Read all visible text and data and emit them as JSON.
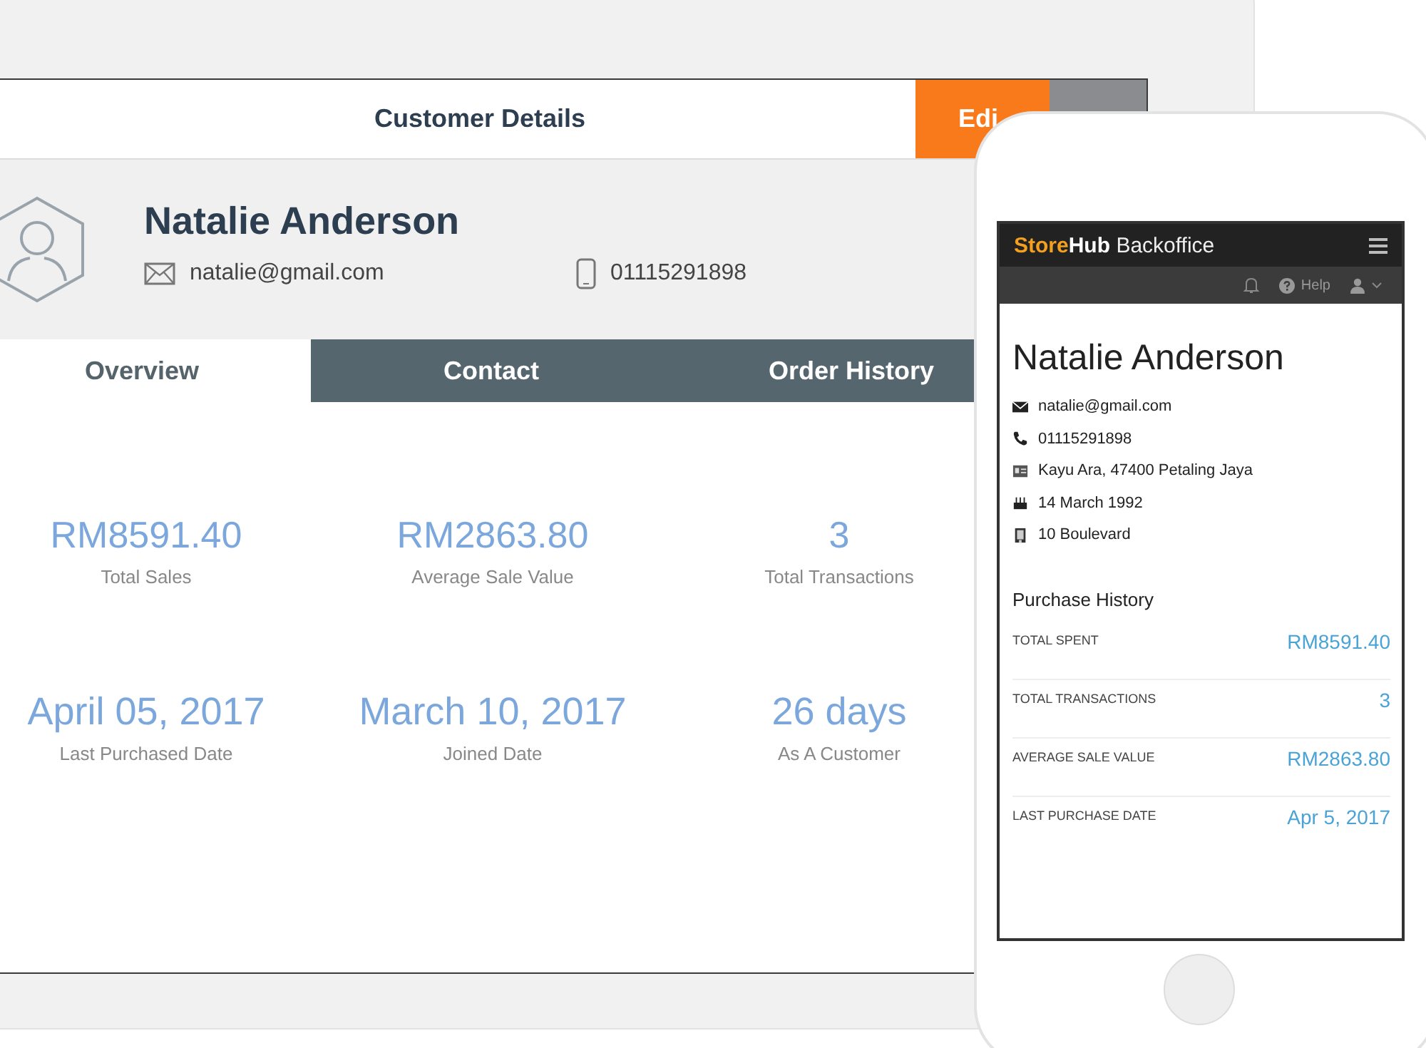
{
  "tablet": {
    "title": "Customer Details",
    "edit_button": "Edi",
    "customer": {
      "name": "Natalie Anderson",
      "email": "natalie@gmail.com",
      "phone": "01115291898"
    },
    "tabs": [
      {
        "label": "Overview",
        "selected": true
      },
      {
        "label": "Contact",
        "selected": false
      },
      {
        "label": "Order History",
        "selected": false
      }
    ],
    "stats": [
      {
        "value": "RM8591.40",
        "label": "Total Sales"
      },
      {
        "value": "RM2863.80",
        "label": "Average Sale Value"
      },
      {
        "value": "3",
        "label": "Total Transactions"
      },
      {
        "value": "April 05, 2017",
        "label": "Last Purchased Date"
      },
      {
        "value": "March 10, 2017",
        "label": "Joined Date"
      },
      {
        "value": "26 days",
        "label": "As A Customer"
      }
    ]
  },
  "phone": {
    "brand": {
      "store": "Store",
      "hub": "Hub",
      "product": "Backoffice"
    },
    "help": "Help",
    "name": "Natalie Anderson",
    "details": [
      {
        "kind": "email",
        "text": "natalie@gmail.com"
      },
      {
        "kind": "phone",
        "text": "01115291898"
      },
      {
        "kind": "address",
        "text": "Kayu Ara, 47400 Petaling Jaya"
      },
      {
        "kind": "birthday",
        "text": "14 March 1992"
      },
      {
        "kind": "building",
        "text": "10 Boulevard"
      }
    ],
    "section_title": "Purchase History",
    "rows": [
      {
        "label": "TOTAL SPENT",
        "value": "RM8591.40"
      },
      {
        "label": "TOTAL TRANSACTIONS",
        "value": "3"
      },
      {
        "label": "AVERAGE SALE VALUE",
        "value": "RM2863.80"
      },
      {
        "label": "LAST PURCHASE DATE",
        "value": "Apr 5, 2017"
      }
    ]
  }
}
